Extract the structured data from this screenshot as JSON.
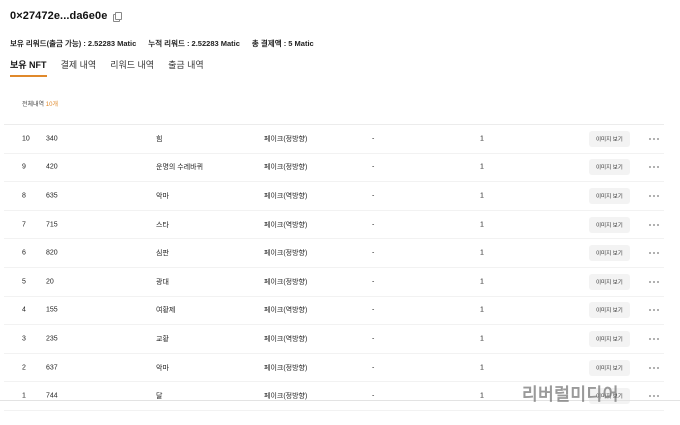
{
  "wallet": {
    "address": "0×27472e...da6e0e"
  },
  "summary": {
    "held_reward": "보유 리워드(출금 가능) : 2.52283 Matic",
    "total_reward": "누적 리워드 : 2.52283 Matic",
    "total_payment": "총 결제액 : 5 Matic"
  },
  "tabs": [
    {
      "label": "보유 NFT",
      "active": true
    },
    {
      "label": "결제 내역"
    },
    {
      "label": "리워드 내역"
    },
    {
      "label": "출금 내역"
    }
  ],
  "count": {
    "prefix": "전체내역",
    "value": "10개"
  },
  "image_button_label": "이미지 보기",
  "rows": [
    {
      "idx": "10",
      "id": "340",
      "name": "힘",
      "type": "페이크(정방향)",
      "dash": "-",
      "qty": "1"
    },
    {
      "idx": "9",
      "id": "420",
      "name": "운명의 수레바퀴",
      "type": "페이크(정방향)",
      "dash": "-",
      "qty": "1"
    },
    {
      "idx": "8",
      "id": "635",
      "name": "악마",
      "type": "페이크(역방향)",
      "dash": "-",
      "qty": "1"
    },
    {
      "idx": "7",
      "id": "715",
      "name": "스타",
      "type": "페이크(역방향)",
      "dash": "-",
      "qty": "1"
    },
    {
      "idx": "6",
      "id": "820",
      "name": "심판",
      "type": "페이크(정방향)",
      "dash": "-",
      "qty": "1"
    },
    {
      "idx": "5",
      "id": "20",
      "name": "광대",
      "type": "페이크(정방향)",
      "dash": "-",
      "qty": "1"
    },
    {
      "idx": "4",
      "id": "155",
      "name": "여황제",
      "type": "페이크(역방향)",
      "dash": "-",
      "qty": "1"
    },
    {
      "idx": "3",
      "id": "235",
      "name": "교황",
      "type": "페이크(역방향)",
      "dash": "-",
      "qty": "1"
    },
    {
      "idx": "2",
      "id": "637",
      "name": "악마",
      "type": "페이크(정방향)",
      "dash": "-",
      "qty": "1"
    },
    {
      "idx": "1",
      "id": "744",
      "name": "달",
      "type": "페이크(정방향)",
      "dash": "-",
      "qty": "1"
    }
  ],
  "watermark": "리버럴미디어",
  "colors": {
    "accent": "#e0892b"
  }
}
